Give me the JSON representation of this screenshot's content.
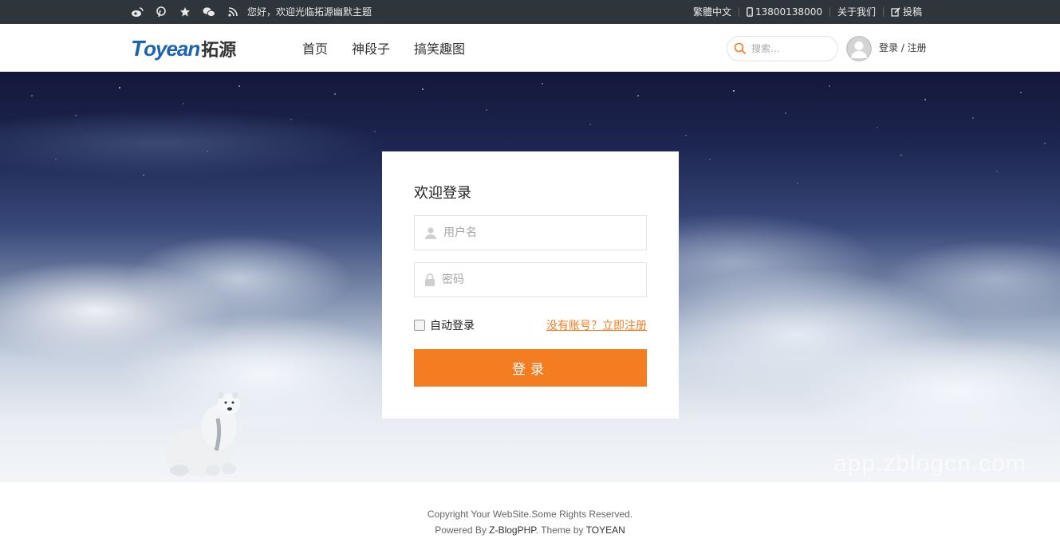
{
  "topbar": {
    "icons": [
      "weibo-icon",
      "pinterest-icon",
      "star-icon",
      "wechat-icon",
      "rss-icon"
    ],
    "greeting": "您好，欢迎光临拓源幽默主题",
    "lang": "繁體中文",
    "phone": "13800138000",
    "about": "关于我们",
    "submit": "投稿"
  },
  "header": {
    "logo_latin_first": "T",
    "logo_latin_rest": "oyean",
    "logo_cn": "拓源",
    "nav": [
      "首页",
      "神段子",
      "搞笑趣图"
    ],
    "search_placeholder": "搜索...",
    "login_text": "登录 / 注册"
  },
  "login": {
    "title": "欢迎登录",
    "username_placeholder": "用户名",
    "password_placeholder": "密码",
    "remember_label": "自动登录",
    "register_link": "没有账号？立即注册",
    "submit_label": "登录"
  },
  "watermark": "app.zblogcn.com",
  "footer": {
    "copyright": "Copyright Your WebSite.Some Rights Reserved.",
    "powered_prefix": "Powered By ",
    "powered_link": "Z-BlogPHP",
    "theme_prefix": ". Theme by ",
    "theme_link": "TOYEAN"
  },
  "colors": {
    "accent": "#f47d22",
    "topbar_bg": "#2e353b",
    "logo_blue": "#1c64b0"
  }
}
